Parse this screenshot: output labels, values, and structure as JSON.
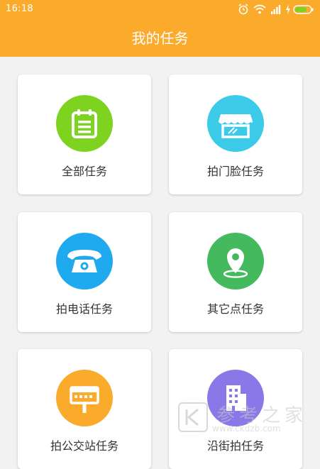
{
  "status_bar": {
    "time": "16:18",
    "icons": [
      "alarm-icon",
      "wifi-icon",
      "signal-icon",
      "charging-icon",
      "battery-icon"
    ]
  },
  "header": {
    "title": "我的任务"
  },
  "tasks": [
    {
      "label": "全部任务",
      "icon": "notepad-icon",
      "color": "#7ed321"
    },
    {
      "label": "拍门脸任务",
      "icon": "storefront-icon",
      "color": "#3bcbe8"
    },
    {
      "label": "拍电话任务",
      "icon": "telephone-icon",
      "color": "#1fa9ee"
    },
    {
      "label": "其它点任务",
      "icon": "location-pin-icon",
      "color": "#44b95e"
    },
    {
      "label": "拍公交站任务",
      "icon": "bus-stop-sign-icon",
      "color": "#fbab2c"
    },
    {
      "label": "沿街拍任务",
      "icon": "building-icon",
      "color": "#8a78e8"
    }
  ],
  "watermark": {
    "text": "参考之家",
    "url": "www.ckdzb.com"
  },
  "colors": {
    "appbar": "#fbab2c",
    "background": "#f2f2f2",
    "card": "#ffffff"
  }
}
